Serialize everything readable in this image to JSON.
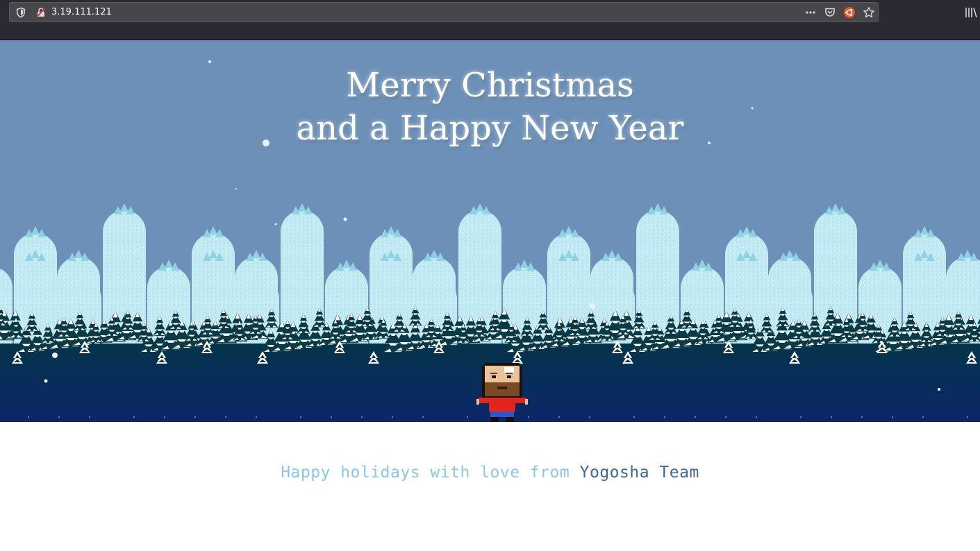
{
  "browser": {
    "url": "3.19.111.121",
    "icons": {
      "tracking": "shield-icon",
      "connection": "insecure-lock-icon",
      "page_actions": "more-horizontal-icon",
      "pocket": "pocket-icon",
      "extension": "ubuntu-extension-icon",
      "bookmark": "star-icon",
      "library": "library-icon"
    }
  },
  "greeting": {
    "line1": "Merry Christmas",
    "line2": "and a Happy New Year"
  },
  "message": {
    "lead": "Happy holidays with love from ",
    "team": "Yogosha Team"
  },
  "colors": {
    "sky": "#6d90b8",
    "ice": "#bfeaf4",
    "forest": "#0b3a4a",
    "ground": "#0e2b6b",
    "lead_text": "#8cc7e6",
    "team_text": "#3f6a95"
  }
}
